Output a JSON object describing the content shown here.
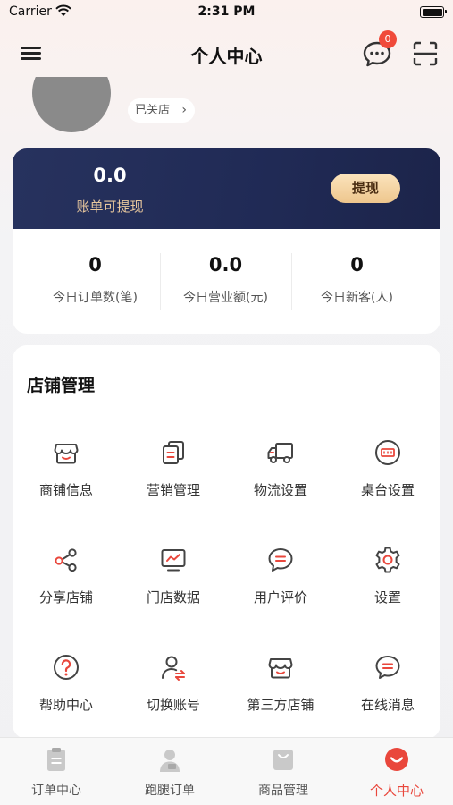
{
  "status_bar": {
    "carrier": "Carrier",
    "time": "2:31 PM"
  },
  "nav": {
    "title": "个人中心",
    "message_badge": "0"
  },
  "profile": {
    "shop_status": "已关店"
  },
  "balance": {
    "value": "0.0",
    "label": "账单可提现",
    "withdraw_label": "提现"
  },
  "stats": [
    {
      "value": "0",
      "label": "今日订单数(笔)"
    },
    {
      "value": "0.0",
      "label": "今日营业额(元)"
    },
    {
      "value": "0",
      "label": "今日新客(人)"
    }
  ],
  "store_management": {
    "title": "店铺管理",
    "items": [
      {
        "label": "商铺信息",
        "icon": "shop-icon"
      },
      {
        "label": "营销管理",
        "icon": "marketing-icon"
      },
      {
        "label": "物流设置",
        "icon": "truck-icon"
      },
      {
        "label": "桌台设置",
        "icon": "table-icon"
      },
      {
        "label": "分享店铺",
        "icon": "share-icon"
      },
      {
        "label": "门店数据",
        "icon": "monitor-chart-icon"
      },
      {
        "label": "用户评价",
        "icon": "comment-icon"
      },
      {
        "label": "设置",
        "icon": "gear-icon"
      },
      {
        "label": "帮助中心",
        "icon": "help-icon"
      },
      {
        "label": "切换账号",
        "icon": "switch-account-icon"
      },
      {
        "label": "第三方店铺",
        "icon": "third-party-shop-icon"
      },
      {
        "label": "在线消息",
        "icon": "chat-icon"
      }
    ]
  },
  "tabbar": {
    "tabs": [
      {
        "label": "订单中心",
        "icon": "clipboard-icon"
      },
      {
        "label": "跑腿订单",
        "icon": "courier-icon"
      },
      {
        "label": "商品管理",
        "icon": "bag-icon"
      },
      {
        "label": "个人中心",
        "icon": "smile-icon",
        "active": true
      }
    ]
  },
  "colors": {
    "accent": "#e9473c",
    "card_navy": "#222c58",
    "gold": "#eec68d"
  }
}
